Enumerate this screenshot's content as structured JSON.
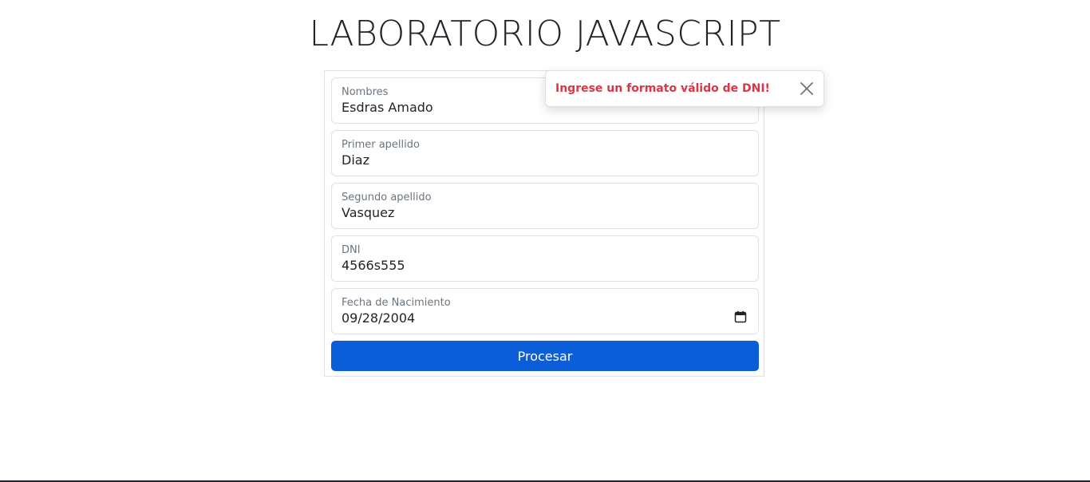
{
  "page": {
    "title": "LABORATORIO JAVASCRIPT"
  },
  "form": {
    "fields": [
      {
        "label": "Nombres",
        "value": "Esdras Amado"
      },
      {
        "label": "Primer apellido",
        "value": "Diaz"
      },
      {
        "label": "Segundo apellido",
        "value": "Vasquez"
      },
      {
        "label": "DNI",
        "value": "4566s555"
      },
      {
        "label": "Fecha de Nacimiento",
        "value": "09/28/2004",
        "icon": "calendar-icon"
      }
    ],
    "submit_label": "Procesar",
    "accent_color": "#0b5ed7"
  },
  "toast": {
    "message": "Ingrese un formato válido de DNI!",
    "message_color": "#dc3545",
    "close_icon": "close-icon"
  }
}
